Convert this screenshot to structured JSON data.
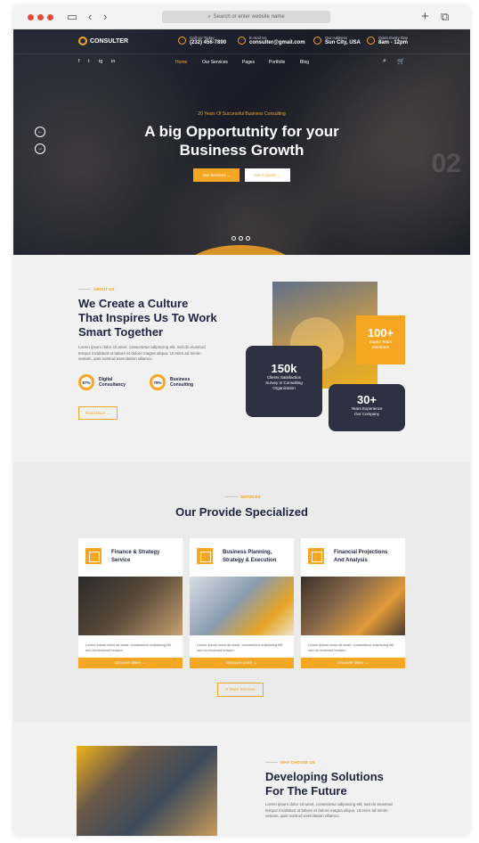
{
  "browser": {
    "url_placeholder": "Search or enter website name"
  },
  "header": {
    "logo": "CONSULTER",
    "call_label": "Call Us Today",
    "call_value": "(232) 456-7890",
    "mail_label": "E-mail Us",
    "mail_value": "consulter@gmail.com",
    "address_label": "Our Address",
    "address_value": "Sun City, USA",
    "hours_label": "Open Every Day",
    "hours_value": "8am - 12pm"
  },
  "social": [
    "f",
    "t",
    "ig",
    "in"
  ],
  "nav": [
    "Home",
    "Our Services",
    "Pages",
    "Portfolio",
    "Blog"
  ],
  "hero": {
    "kicker": "20 Years Of Successful Business Consulting",
    "title_line1": "A big Opportutnity for your",
    "title_line2": "Business Growth",
    "btn_primary": "Our Services",
    "btn_secondary": "Get A Quote",
    "slide_number": "02"
  },
  "about": {
    "label": "ABOUT US",
    "title_line1": "We Create a Culture",
    "title_line2": "That Inspires Us To Work",
    "title_line3": "Smart Together",
    "text": "Lorem ipsum dolor sit amet, consectetur adipiscing elit, sed do eiusmod tempor incididunt ut labore et dolore magna aliqua. Ut enim ad minim veniam, quis nostrud exercitation ullamco.",
    "stat1_value": "87%",
    "stat1_label_1": "Digital",
    "stat1_label_2": "Consultancy",
    "stat2_value": "79%",
    "stat2_label_1": "Business",
    "stat2_label_2": "Consulting",
    "read_more": "Read More",
    "box1_value": "100+",
    "box1_label_1": "Expert Team",
    "box1_label_2": "Members",
    "box2_value": "150k",
    "box2_label_1": "Clients Satisfaction",
    "box2_label_2": "Survey In Consulting",
    "box2_label_3": "Organization",
    "box3_value": "30+",
    "box3_label_1": "Years Experience",
    "box3_label_2": "Our Company"
  },
  "services": {
    "label": "SERVICES",
    "title": "Our Provide Specialized",
    "cards": [
      {
        "title_1": "Finance & Strategy",
        "title_2": "Service",
        "text": "Lorem ipsum dolor sit amet, consectetur adipiscing elit sed do eiusmod tempor.",
        "button": "Discover More"
      },
      {
        "title_1": "Business Planning,",
        "title_2": "Strategy & Execution",
        "text": "Lorem ipsum dolor sit amet, consectetur adipiscing elit sed do eiusmod tempor.",
        "button": "Discover More"
      },
      {
        "title_1": "Financial Projections",
        "title_2": "And Analysis",
        "text": "Lorem ipsum dolor sit amet, consectetur adipiscing elit sed do eiusmod tempor.",
        "button": "Discover More"
      }
    ],
    "more_button": "More Services"
  },
  "why": {
    "label": "WHY CHOOSE US",
    "title_line1": "Developing Solutions",
    "title_line2": "For The Future",
    "text": "Lorem ipsum dolor sit amet, consectetur adipiscing elit, sed do eiusmod tempor incididunt ut labore et dolore magna aliqua. Ut enim ad minim veniam, quis nostrud exercitation ullamco."
  },
  "colors": {
    "accent": "#f5a623",
    "dark": "#2d3142"
  }
}
